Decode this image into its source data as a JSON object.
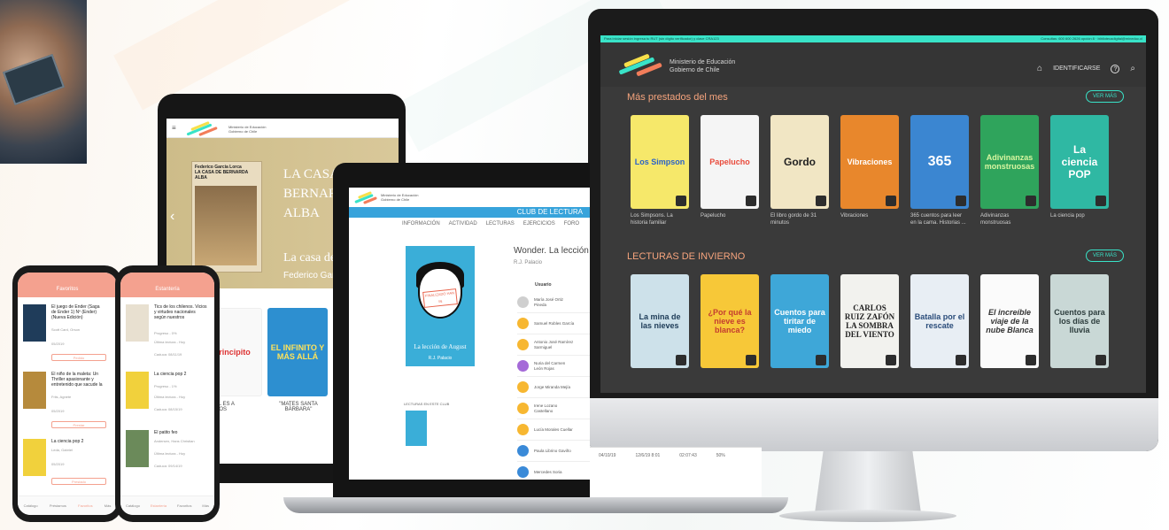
{
  "monitor": {
    "topbar_left": "Para iniciar sesión ingresa tu RUT (sin dígito verificador) y clave CRA123",
    "topbar_right": "Consultas: 600 600 2626 opción 8 · bibliotecadigital@mineduc.cl",
    "ministry_line1": "Ministerio de Educación",
    "ministry_line2": "Gobierno de Chile",
    "nav_home": "⌂",
    "nav_login": "IDENTIFICARSE",
    "nav_help": "?",
    "nav_search": "⌕",
    "section1_title": "Más prestados del mes",
    "section2_title": "LECTURAS DE INVIERNO",
    "ver_mas": "VER MÁS",
    "row1": [
      {
        "title": "Los Simpson",
        "caption": "Los Simpsons. La historia familiar",
        "bg": "#f6e86a",
        "fg": "#2a62c9"
      },
      {
        "title": "Papelucho",
        "caption": "Papelucho",
        "bg": "#f5f5f5",
        "fg": "#e94b3c"
      },
      {
        "title": "Gordo",
        "caption": "El libro gordo de 31 minutos",
        "bg": "#f1e6c4",
        "fg": "#222"
      },
      {
        "title": "Vibraciones",
        "caption": "Vibraciones",
        "bg": "#e8872c",
        "fg": "#fff"
      },
      {
        "title": "365",
        "caption": "365 cuentos para leer en la cama. Historias ...",
        "bg": "#3b86d1",
        "fg": "#fff"
      },
      {
        "title": "Adivinanzas monstruosas",
        "caption": "Adivinanzas monstruosas",
        "bg": "#2fa45c",
        "fg": "#d6f5a0"
      },
      {
        "title": "La ciencia POP",
        "caption": "La ciencia pop",
        "bg": "#2fb8a3",
        "fg": "#fff"
      }
    ],
    "row2": [
      {
        "title": "La mina de las nieves",
        "bg": "#cde1ea",
        "fg": "#1d3b57"
      },
      {
        "title": "¿Por qué la nieve es blanca?",
        "bg": "#f7c838",
        "fg": "#c43c2f"
      },
      {
        "title": "Cuentos para tiritar de miedo",
        "bg": "#3ea7d8",
        "fg": "#fff"
      },
      {
        "title": "CARLOS RUIZ ZAFÓN LA SOMBRA DEL VIENTO",
        "bg": "#f2f2ee",
        "fg": "#222"
      },
      {
        "title": "Batalla por el rescate",
        "bg": "#e8eef4",
        "fg": "#2a4c7a"
      },
      {
        "title": "El increíble viaje de la nube Blanca",
        "bg": "#fbfbfb",
        "fg": "#333"
      },
      {
        "title": "Cuentos para los días de lluvia",
        "bg": "#c9d8d6",
        "fg": "#2d3d3d"
      }
    ]
  },
  "tablet": {
    "ministry": "Ministerio de Educación Gobierno de Chile",
    "hero_title": "LA CASA DE BERNARDA ALBA",
    "hero_sub": "La casa de",
    "hero_author": "Federico Garc",
    "hero_book_author": "Federico García Lorca",
    "hero_book_title": "LA CASA DE BERNARDA ALBA",
    "books": [
      {
        "title": "Principito",
        "bg": "#f9f9f9",
        "fg": "#d33"
      },
      {
        "title": "EL INFINITO Y MÁS ALLÁ",
        "bg": "#2d8fd0",
        "fg": "#ffe35a"
      },
      {
        "title": "",
        "bg": "#3a9a5a",
        "fg": "#fff"
      }
    ],
    "caption1": "ICIAL ES A LOS",
    "caption2": "\"MATES SANTA BÁRBARA\""
  },
  "laptop": {
    "ministry": "Ministerio de Educación Gobierno de Chile",
    "club": "CLUB DE LECTURA",
    "tabs": [
      "INFORMACIÓN",
      "ACTIVIDAD",
      "LECTURAS",
      "EJERCICIOS",
      "FORO"
    ],
    "book_title": "Wonder. La lección de",
    "book_author": "R.J. Palacio",
    "cover_title": "La lección de August",
    "cover_author": "R.J. Palacio",
    "stamp": "FINALIZADO HAN IN",
    "col_user": "Usuario",
    "lecturas_label": "LECTURAS EN ESTE CLUB",
    "members": [
      {
        "name": "María José Ortiz Pineda",
        "color": "#cfcfcf"
      },
      {
        "name": "Samuel Robles García",
        "color": "#f7b731"
      },
      {
        "name": "Antonio José Ramírez Sarmiguel",
        "color": "#f7b731"
      },
      {
        "name": "Nuria del Carmen León Rojas",
        "color": "#a56ad8"
      },
      {
        "name": "Jorge Miranda Mejía",
        "color": "#f7b731"
      },
      {
        "name": "Irene Lozano Castellano",
        "color": "#f7b731"
      },
      {
        "name": "Lucía Morales Cuellar",
        "color": "#f7b731"
      },
      {
        "name": "Paula Librino Gaviño",
        "color": "#3a8ad8"
      },
      {
        "name": "Mercedes Soria",
        "color": "#3a8ad8"
      }
    ],
    "extra": [
      "04/10/19",
      "12/6/19 8:01",
      "02:07:43",
      "50%"
    ]
  },
  "phone1": {
    "header": "Favoritos",
    "items": [
      {
        "title": "El juego de Ender (Saga de Ender 1) Nº (Ender) (Nueva Edición)",
        "sub": "Scott Card, Orson",
        "date": "05/2019",
        "button": "Pedido",
        "cover": "#1f3c5a"
      },
      {
        "title": "El niño de la maleta: Un Thriller apasionante y entretenido que sacude la",
        "sub": "Friis, Agnete",
        "date": "05/2019",
        "button": "Prestar",
        "cover": "#b68a3c"
      },
      {
        "title": "La ciencia pop 2",
        "sub": "Leda, Gabriel",
        "date": "05/2019",
        "button": "Prestado",
        "cover": "#f1d13c"
      }
    ],
    "nav": [
      "Catálogo",
      "Préstamos",
      "Favoritos",
      "Más"
    ]
  },
  "phone2": {
    "header": "Estantería",
    "items": [
      {
        "title": "Tics de los chilenos. Vicios y virtudes nacionales según nuestros",
        "progress": "Progreso - 0%",
        "last": "Última lectura - Hoy",
        "date": "Caduca: 08/11/19",
        "cover": "#e8e0d0"
      },
      {
        "title": "La ciencia pop 2",
        "progress": "Progreso - 1%",
        "last": "Última lectura - Hoy",
        "date": "Caduca: 08/15/19",
        "cover": "#f1d13c"
      },
      {
        "title": "El patito feo",
        "progress": "Andersen, Hans Christian",
        "last": "Última lectura - Hoy",
        "date": "Caduca: 09/14/19",
        "cover": "#6b8a5a"
      }
    ],
    "nav": [
      "Catálogo",
      "Estantería",
      "Favoritos",
      "Más"
    ]
  }
}
